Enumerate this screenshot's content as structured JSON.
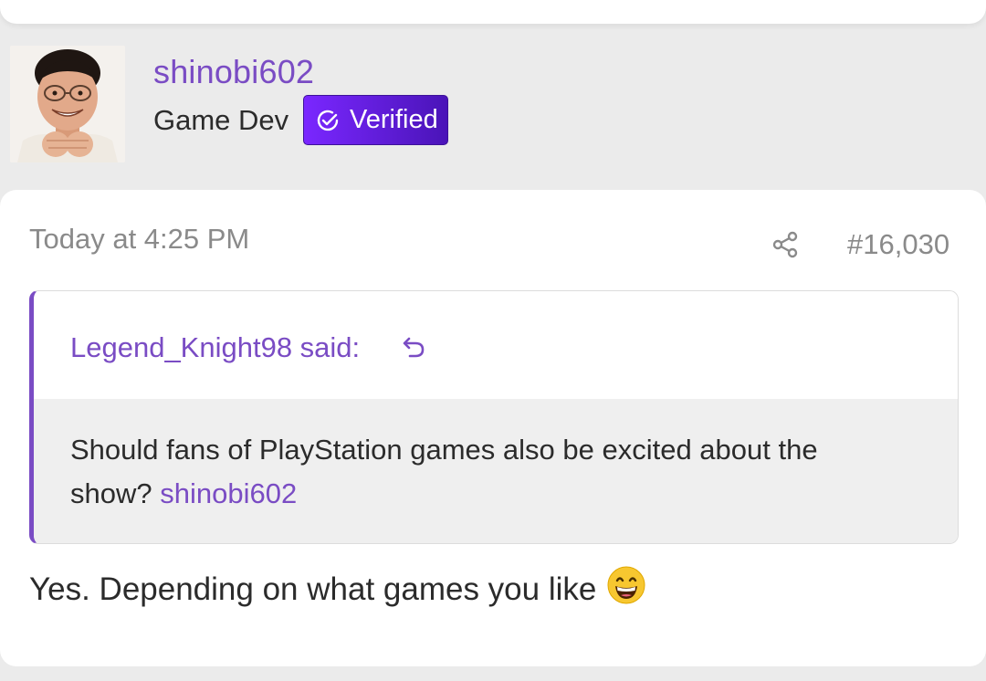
{
  "author": {
    "username": "shinobi602",
    "title": "Game Dev",
    "badge_label": "Verified"
  },
  "post": {
    "timestamp": "Today at 4:25 PM",
    "number": "#16,030",
    "quote": {
      "author_line": "Legend_Knight98 said:",
      "text_line1": "Should fans of PlayStation games also be excited about the",
      "text_line2_prefix": "show? ",
      "mention": "shinobi602"
    },
    "body": "Yes. Depending on what games you like"
  },
  "colors": {
    "accent": "#7a4cc4",
    "badge_start": "#7a27ff",
    "badge_end": "#4a14b8",
    "meta_gray": "#8a8a8a",
    "page_bg": "#ebebeb",
    "quote_bg": "#efefef"
  },
  "icons": {
    "badge": "check-circle-icon",
    "share": "share-icon",
    "quote_jump": "jump-to-quote-icon",
    "emoji": "grinning-face-emoji"
  }
}
